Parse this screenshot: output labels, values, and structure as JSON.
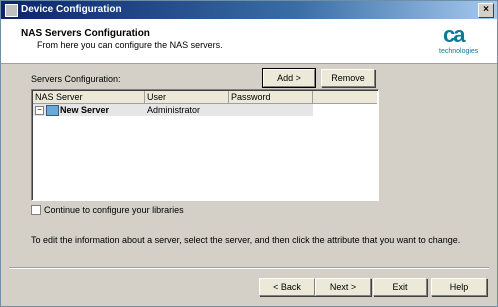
{
  "window": {
    "title": "Device Configuration",
    "close_glyph": "×"
  },
  "header": {
    "title": "NAS Servers Configuration",
    "subtitle": "From here you can configure the NAS servers.",
    "logo_text": "ca",
    "logo_tagline": "technologies"
  },
  "servers": {
    "label": "Servers Configuration:",
    "add_label": "Add >",
    "remove_label": "Remove",
    "columns": [
      "NAS Server",
      "User",
      "Password"
    ],
    "rows": [
      {
        "name": "New Server",
        "user": "Administrator",
        "password": ""
      }
    ]
  },
  "continue_option": {
    "label": "Continue to configure your libraries",
    "checked": false
  },
  "info_text": "To edit the information about a server, select the server, and then click the attribute that you want to change.",
  "footer": {
    "back": "< Back",
    "next": "Next >",
    "exit": "Exit",
    "help": "Help"
  },
  "icons": {
    "expander": "minus-box-icon",
    "server": "server-icon",
    "logo": "ca-logo-icon"
  }
}
